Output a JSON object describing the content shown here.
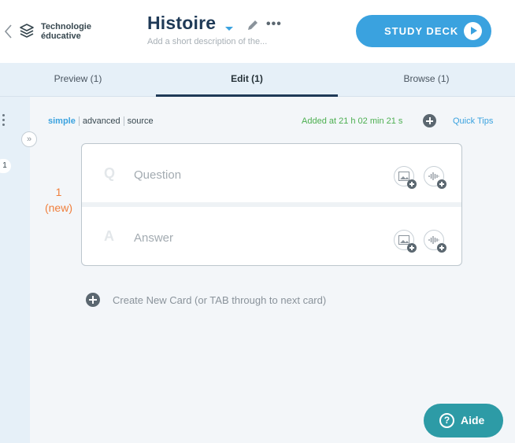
{
  "header": {
    "folder_line1": "Technologie",
    "folder_line2": "éducative",
    "deck_title": "Histoire",
    "more_label": "•••",
    "description_placeholder": "Add a short description of the...",
    "study_button": "STUDY DECK"
  },
  "tabs": [
    {
      "label": "Preview (1)"
    },
    {
      "label": "Edit (1)",
      "active": true
    },
    {
      "label": "Browse (1)"
    }
  ],
  "rail": {
    "card_number": "1",
    "expand_label": "»"
  },
  "editor": {
    "modes": [
      "simple",
      "advanced",
      "source"
    ],
    "active_mode": "simple",
    "added_status": "Added at 21 h 02 min 21 s",
    "quick_tips": "Quick Tips"
  },
  "card": {
    "number": "1",
    "status": "(new)",
    "question_letter": "Q",
    "question_placeholder": "Question",
    "answer_letter": "A",
    "answer_placeholder": "Answer"
  },
  "create_card": "Create New Card (or TAB through to next card)",
  "help_button": {
    "icon_text": "?",
    "label": "Aide"
  },
  "colors": {
    "accent": "#3aa2df",
    "title": "#1f3a57",
    "added": "#4caf50",
    "new_card": "#f07f3c",
    "help": "#2d9ba6"
  },
  "icons": [
    "chevron-left-icon",
    "stack-icon",
    "caret-down-icon",
    "pencil-icon",
    "more-icon",
    "play-icon",
    "image-icon",
    "audio-icon",
    "plus-circle-icon",
    "help-icon"
  ]
}
